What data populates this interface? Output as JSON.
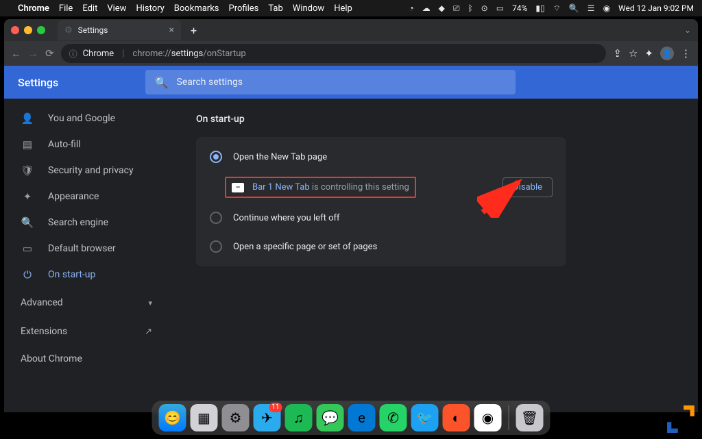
{
  "menubar": {
    "app": "Chrome",
    "items": [
      "File",
      "Edit",
      "View",
      "History",
      "Bookmarks",
      "Profiles",
      "Tab",
      "Window",
      "Help"
    ],
    "battery": "74%",
    "datetime": "Wed 12 Jan  9:02 PM"
  },
  "tab": {
    "title": "Settings"
  },
  "omnibox": {
    "host": "Chrome",
    "path_prefix": "chrome://",
    "path_mid": "settings",
    "path_suffix": "/onStartup"
  },
  "settings": {
    "title": "Settings",
    "search_placeholder": "Search settings",
    "sidebar": [
      {
        "icon": "person",
        "label": "You and Google"
      },
      {
        "icon": "autofill",
        "label": "Auto-fill"
      },
      {
        "icon": "shield",
        "label": "Security and privacy"
      },
      {
        "icon": "appearance",
        "label": "Appearance"
      },
      {
        "icon": "search",
        "label": "Search engine"
      },
      {
        "icon": "browser",
        "label": "Default browser"
      },
      {
        "icon": "power",
        "label": "On start-up",
        "active": true
      }
    ],
    "advanced": "Advanced",
    "extensions": "Extensions",
    "about": "About Chrome"
  },
  "content": {
    "heading": "On start-up",
    "option1": "Open the New Tab page",
    "ext_name": "Bar 1 New Tab",
    "ext_msg": " is controlling this setting",
    "disable": "Disable",
    "option2": "Continue where you left off",
    "option3": "Open a specific page or set of pages"
  },
  "dock": {
    "telegram_badge": "11"
  }
}
